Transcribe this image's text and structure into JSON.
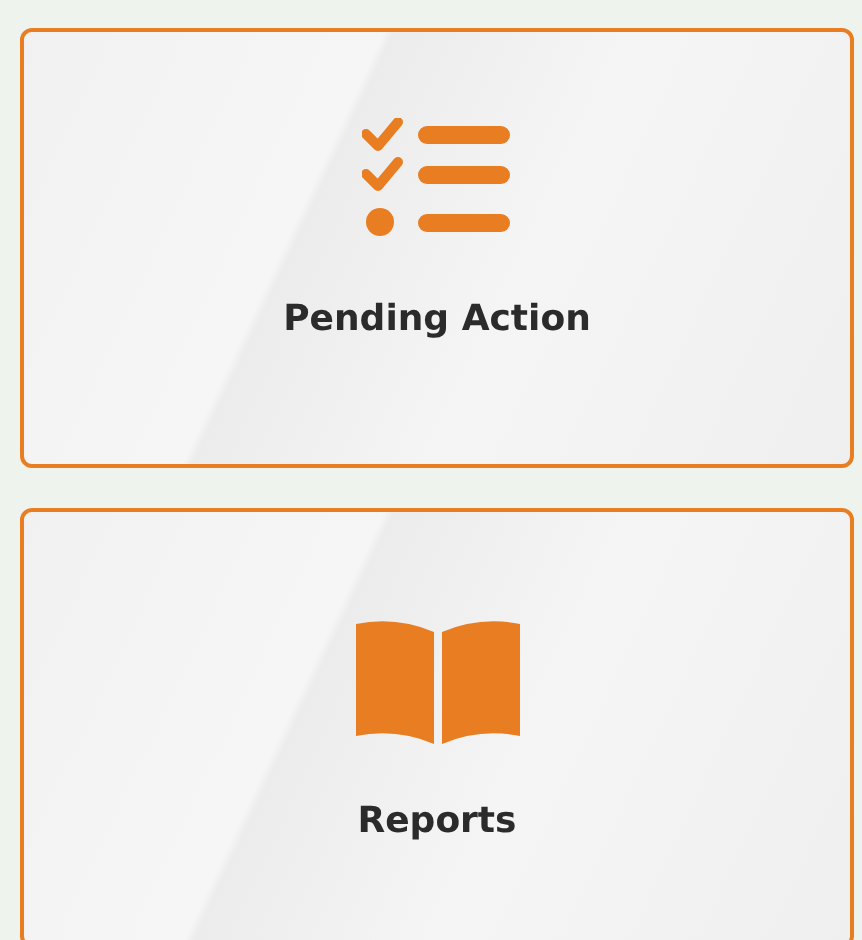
{
  "cards": [
    {
      "label": "Pending Action",
      "kind": "checklist"
    },
    {
      "label": "Reports",
      "kind": "book"
    }
  ]
}
